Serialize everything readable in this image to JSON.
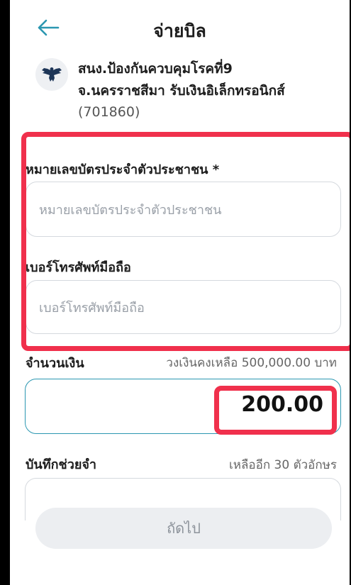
{
  "header": {
    "title": "จ่ายบิล"
  },
  "biller": {
    "line1": "สนง.ป้องกันควบคุมโรคที่9",
    "line2": "จ.นครราชสีมา รับเงินอิเล็กทรอนิกส์",
    "code": "(701860)",
    "logo_icon": "garuda-emblem-icon"
  },
  "form": {
    "id_label": "หมายเลขบัตรประจำตัวประชาชน *",
    "id_placeholder": "หมายเลขบัตรประจำตัวประชาชน",
    "phone_label": "เบอร์โทรศัพท์มือถือ",
    "phone_placeholder": "เบอร์โทรศัพท์มือถือ",
    "amount_label": "จำนวนเงิน",
    "limit_text": "วงเงินคงเหลือ 500,000.00 บาท",
    "amount_value": "200.00",
    "memo_label": "บันทึกช่วยจำ",
    "memo_remaining": "เหลืออีก 30 ตัวอักษร"
  },
  "footer": {
    "next_label": "ถัดไป"
  },
  "colors": {
    "accent": "#2b97b1",
    "highlight": "#f0304c",
    "disabled_button": "#eceef1"
  }
}
